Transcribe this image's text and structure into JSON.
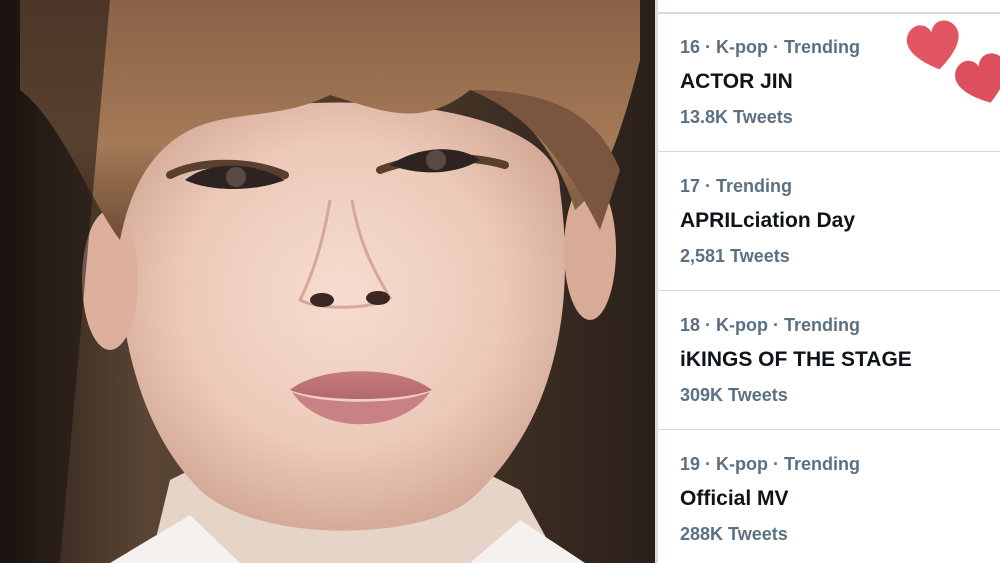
{
  "trends": [
    {
      "meta": "16 · K-pop · Trending",
      "title": "ACTOR JIN",
      "count": "13.8K Tweets"
    },
    {
      "meta": "17 · Trending",
      "title": "APRILciation Day",
      "count": "2,581 Tweets"
    },
    {
      "meta": "18 · K-pop · Trending",
      "title": "iKINGS OF THE STAGE",
      "count": "309K Tweets"
    },
    {
      "meta": "19 · K-pop · Trending",
      "title": "Official MV",
      "count": "288K Tweets"
    }
  ],
  "decorations": {
    "heart_color": "#e0505e",
    "meta_color": "#5b7083",
    "title_color": "#0f1419"
  }
}
